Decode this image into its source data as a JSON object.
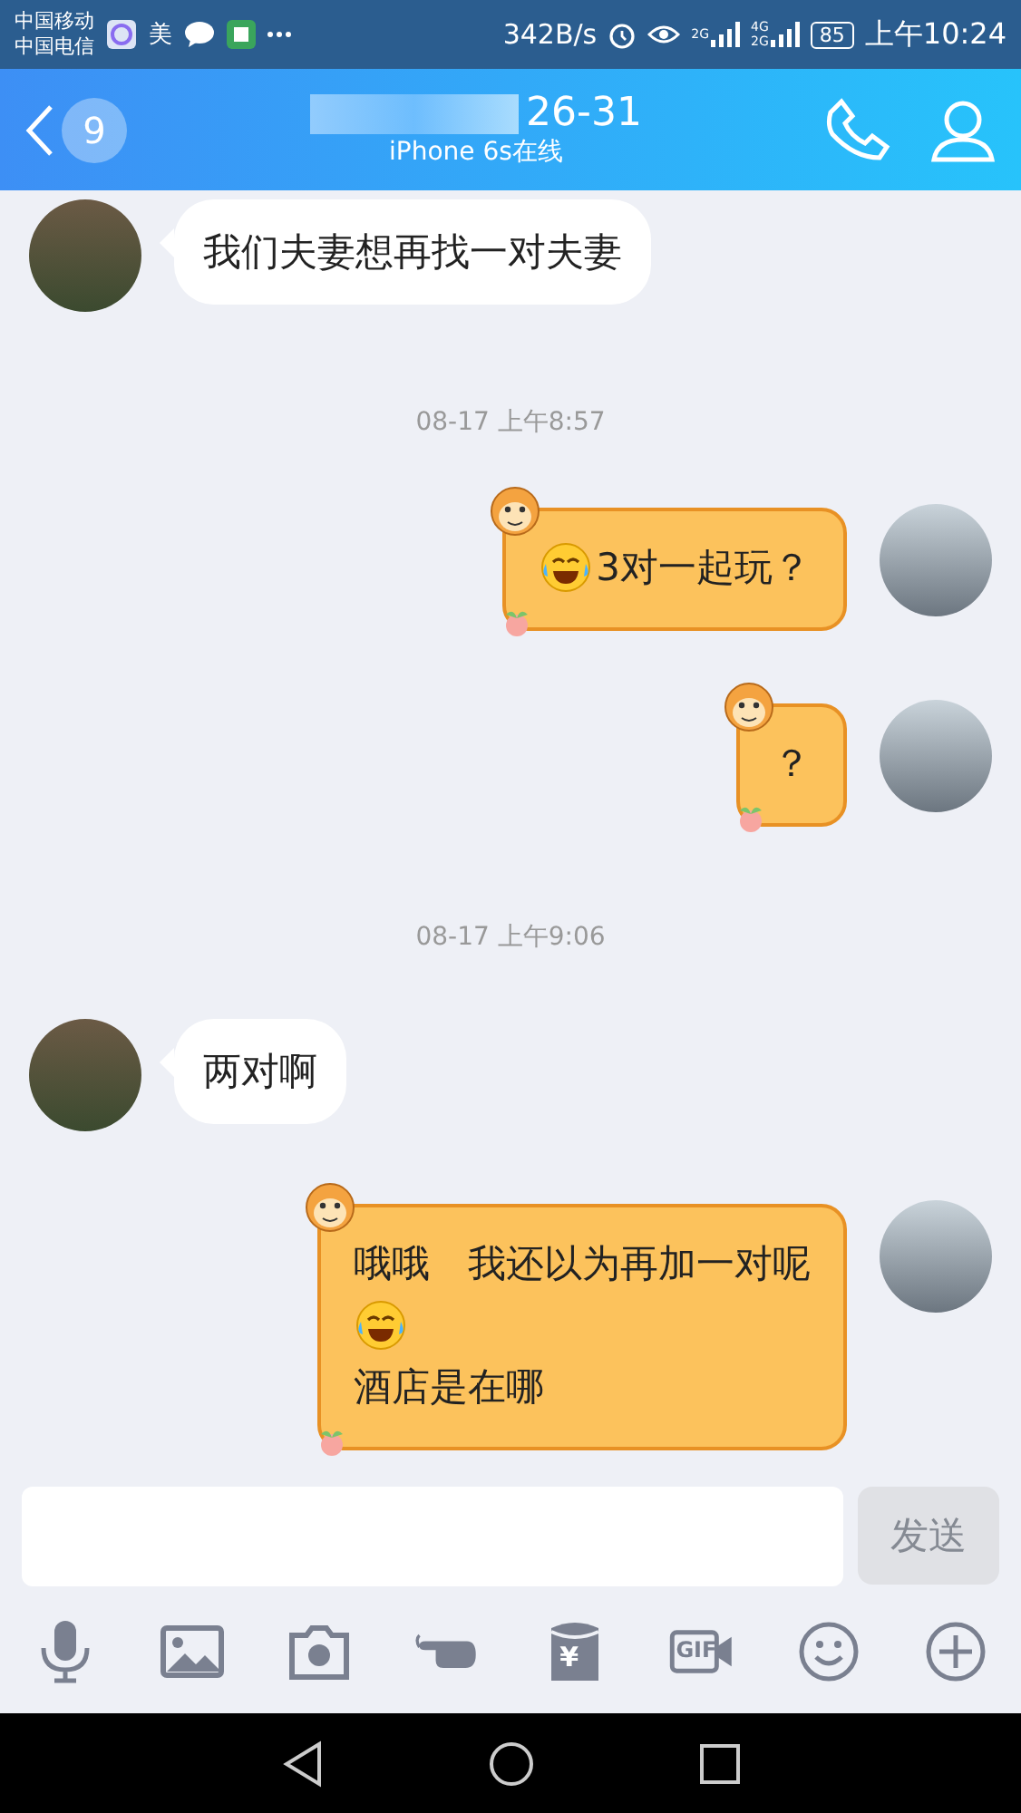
{
  "status_bar": {
    "carriers": [
      "中国移动",
      "中国电信"
    ],
    "notification_text": "美",
    "speed": "342B/s",
    "signals": [
      {
        "labels": [
          "2G"
        ]
      },
      {
        "labels": [
          "4G",
          "2G"
        ]
      }
    ],
    "battery": "85",
    "time": "上午10:24"
  },
  "header": {
    "badge": "9",
    "title": "26-31",
    "subtitle": "iPhone 6s在线"
  },
  "chat": [
    {
      "kind": "received",
      "lines": [
        [
          {
            "kind": "text",
            "text": "我们夫妻想再找一对夫妻"
          }
        ]
      ]
    },
    {
      "kind": "time",
      "text": "08-17 上午8:57"
    },
    {
      "kind": "sent",
      "lines": [
        [
          {
            "kind": "emoji"
          },
          {
            "kind": "text",
            "text": "3对一起玩？"
          }
        ]
      ]
    },
    {
      "kind": "sent",
      "lines": [
        [
          {
            "kind": "text",
            "text": "？"
          }
        ]
      ]
    },
    {
      "kind": "time",
      "text": "08-17 上午9:06"
    },
    {
      "kind": "received",
      "lines": [
        [
          {
            "kind": "text",
            "text": "两对啊"
          }
        ]
      ]
    },
    {
      "kind": "sent",
      "lines": [
        [
          {
            "kind": "text",
            "text": "哦哦　我还以为再加一对呢"
          }
        ],
        [
          {
            "kind": "emoji"
          }
        ],
        [
          {
            "kind": "text",
            "text": "酒店是在哪"
          }
        ]
      ]
    }
  ],
  "send_button": {
    "label": "发送",
    "disabled": true
  },
  "toolbar": [
    {
      "kind": "mic"
    },
    {
      "kind": "image"
    },
    {
      "kind": "camera"
    },
    {
      "kind": "poke"
    },
    {
      "kind": "redpacket",
      "label": "¥"
    },
    {
      "kind": "gif",
      "label": "GIF"
    },
    {
      "kind": "emoji"
    },
    {
      "kind": "plus"
    }
  ]
}
